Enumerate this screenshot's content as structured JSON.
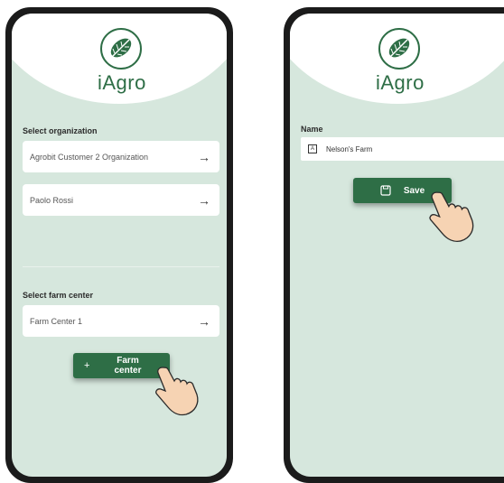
{
  "brand": {
    "name": "iAgro",
    "color": "#2e6e46",
    "logo_icon": "leaf-icon"
  },
  "left_screen": {
    "organization_section_label": "Select organization",
    "organizations": [
      {
        "label": "Agrobit Customer 2 Organization",
        "icon": "arrow-right-icon"
      },
      {
        "label": "Paolo Rossi",
        "icon": "arrow-right-icon"
      }
    ],
    "farm_center_section_label": "Select farm center",
    "farm_centers": [
      {
        "label": "Farm Center 1",
        "icon": "arrow-right-icon"
      }
    ],
    "add_button": {
      "icon_text": "+",
      "label_line1": "Farm",
      "label_line2": "center"
    }
  },
  "right_screen": {
    "name_label": "Name",
    "name_value": "Nelson's Farm",
    "save_button": {
      "label": "Save",
      "icon": "floppy-disk-icon"
    }
  },
  "colors": {
    "screen_bg": "#d6e7dd",
    "button_bg": "#2e6e46"
  }
}
